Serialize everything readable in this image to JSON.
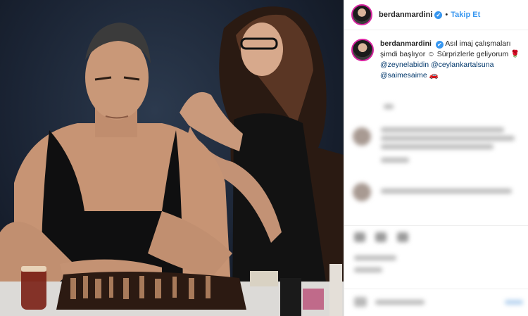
{
  "post": {
    "username": "berdanmardini",
    "verified_mark": "✔",
    "separator": "•",
    "follow_label": "Takip Et",
    "caption_text": "Asıl imaj çalışmaları şimdi başlıyor ☺ Sürprizlerle geliyorum 🌹",
    "mentions": [
      "@zeynelabidin",
      "@ceylankartalsuna",
      "@saimesaime"
    ],
    "trailing_emoji": "🚗"
  },
  "colors": {
    "accent_link": "#3897f0",
    "mention": "#00376b",
    "verified": "#3897f0"
  },
  "icons": [
    "verified-icon",
    "avatar-icon"
  ]
}
